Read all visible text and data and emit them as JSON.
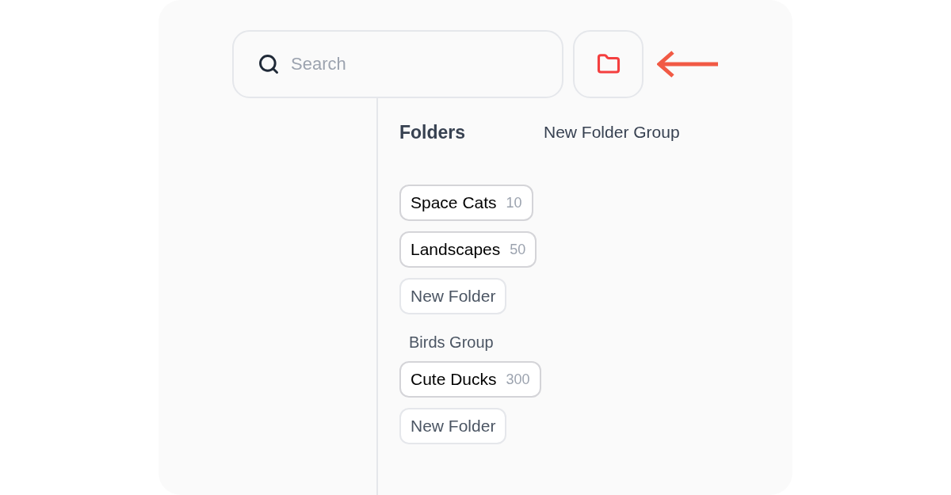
{
  "search": {
    "placeholder": "Search"
  },
  "header": {
    "title": "Folders",
    "action": "New Folder Group"
  },
  "groups": [
    {
      "items": [
        {
          "kind": "folder",
          "name": "Space Cats",
          "count": "10"
        },
        {
          "kind": "folder",
          "name": "Landscapes",
          "count": "50"
        },
        {
          "kind": "new",
          "name": "New Folder"
        }
      ]
    },
    {
      "title": "Birds Group",
      "items": [
        {
          "kind": "folder",
          "name": "Cute Ducks",
          "count": "300"
        },
        {
          "kind": "new",
          "name": "New Folder"
        }
      ]
    }
  ]
}
